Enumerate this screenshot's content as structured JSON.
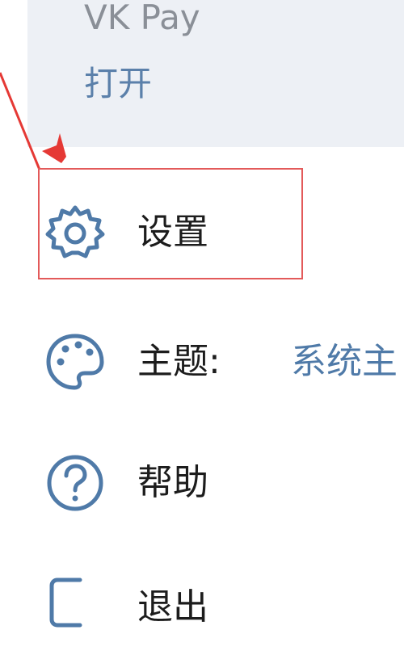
{
  "vkpay": {
    "title": "VK Pay",
    "action": "打开"
  },
  "menu": {
    "settings": {
      "label": "设置",
      "icon": "gear-icon"
    },
    "theme": {
      "label": "主题:",
      "value": "系统主",
      "icon": "palette-icon"
    },
    "help": {
      "label": "帮助",
      "icon": "help-circle-icon"
    },
    "logout": {
      "label": "退出",
      "icon": "logout-icon"
    }
  },
  "colors": {
    "icon": "#4f7aa8",
    "accent": "#4f7aa8",
    "highlight": "#e35a5a",
    "arrow": "#e53935",
    "card_bg": "#edf0f5"
  }
}
